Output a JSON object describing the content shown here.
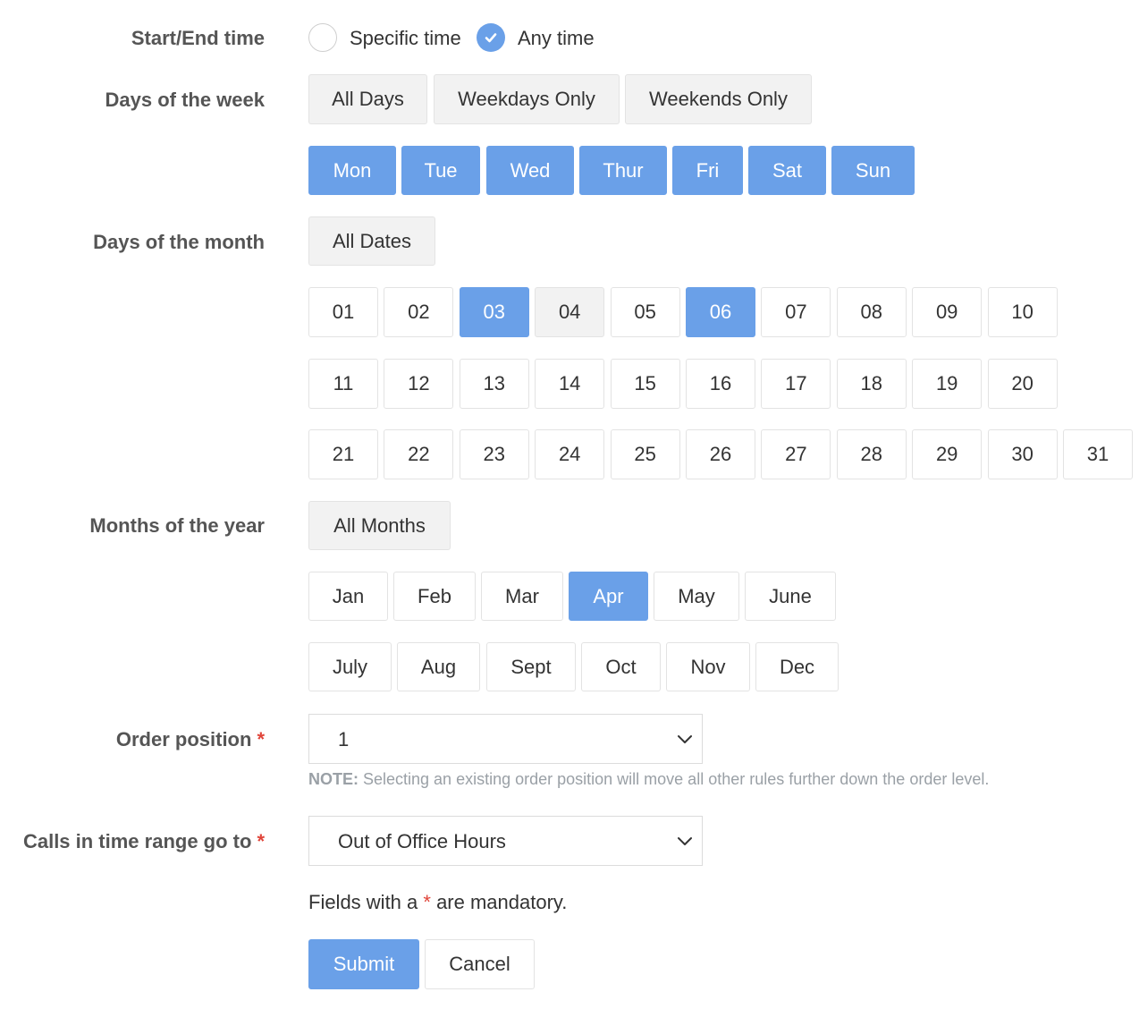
{
  "start_end": {
    "label": "Start/End time",
    "specific_label": "Specific time",
    "any_label": "Any time",
    "selected": "Any time"
  },
  "days_week": {
    "label": "Days of the week",
    "presets": [
      "All Days",
      "Weekdays Only",
      "Weekends Only"
    ],
    "days": [
      "Mon",
      "Tue",
      "Wed",
      "Thur",
      "Fri",
      "Sat",
      "Sun"
    ],
    "selected": [
      "Mon",
      "Tue",
      "Wed",
      "Thur",
      "Fri",
      "Sat",
      "Sun"
    ]
  },
  "days_month": {
    "label": "Days of the month",
    "all_label": "All Dates",
    "dates": [
      "01",
      "02",
      "03",
      "04",
      "05",
      "06",
      "07",
      "08",
      "09",
      "10",
      "11",
      "12",
      "13",
      "14",
      "15",
      "16",
      "17",
      "18",
      "19",
      "20",
      "21",
      "22",
      "23",
      "24",
      "25",
      "26",
      "27",
      "28",
      "29",
      "30",
      "31"
    ],
    "selected": [
      "03",
      "06"
    ],
    "hovered": "04"
  },
  "months": {
    "label": "Months of the year",
    "all_label": "All Months",
    "items": [
      "Jan",
      "Feb",
      "Mar",
      "Apr",
      "May",
      "June",
      "July",
      "Aug",
      "Sept",
      "Oct",
      "Nov",
      "Dec"
    ],
    "selected": [
      "Apr"
    ]
  },
  "order": {
    "label": "Order position",
    "required_mark": "*",
    "value": "1",
    "note_prefix": "NOTE:",
    "note_text": " Selecting an existing order position will move all other rules further down the order level."
  },
  "calls": {
    "label": "Calls in time range go to",
    "required_mark": "*",
    "value": "Out of Office Hours"
  },
  "mandatory": {
    "prefix": "Fields with a ",
    "star": "*",
    "suffix": " are mandatory."
  },
  "actions": {
    "submit": "Submit",
    "cancel": "Cancel"
  },
  "colors": {
    "accent": "#6aa0e8",
    "required": "#e0453a",
    "note": "#9aa0a6"
  }
}
